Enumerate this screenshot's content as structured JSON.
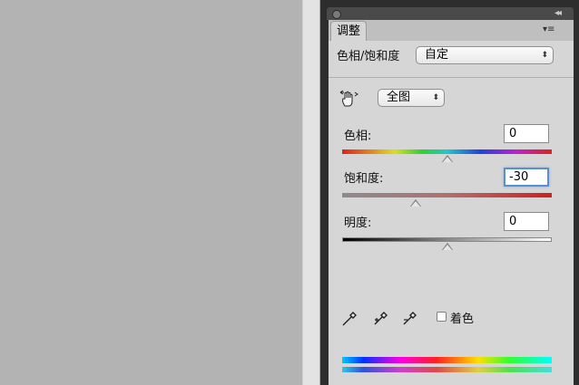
{
  "panel": {
    "tab": "调整",
    "collapse_glyph": "◂◂",
    "menu_glyph": "▾≡"
  },
  "adjustment": {
    "title": "色相/饱和度",
    "preset": "自定"
  },
  "channel": {
    "value": "全图"
  },
  "hue": {
    "label": "色相:",
    "value": "0"
  },
  "saturation": {
    "label": "饱和度:",
    "value": "-30"
  },
  "lightness": {
    "label": "明度:",
    "value": "0"
  },
  "colorize": {
    "label": "着色",
    "checked": false
  },
  "select_arrow": "⬍",
  "icons": {
    "hand": "hand-adjust-icon",
    "eyedropper": "eyedropper-icon",
    "eyedropper_add": "eyedropper-plus-icon",
    "eyedropper_subtract": "eyedropper-minus-icon"
  },
  "colors": {
    "focus": "#5b8fd0",
    "panel_bg": "#d6d6d6",
    "canvas_bg": "#b3b3b3"
  }
}
